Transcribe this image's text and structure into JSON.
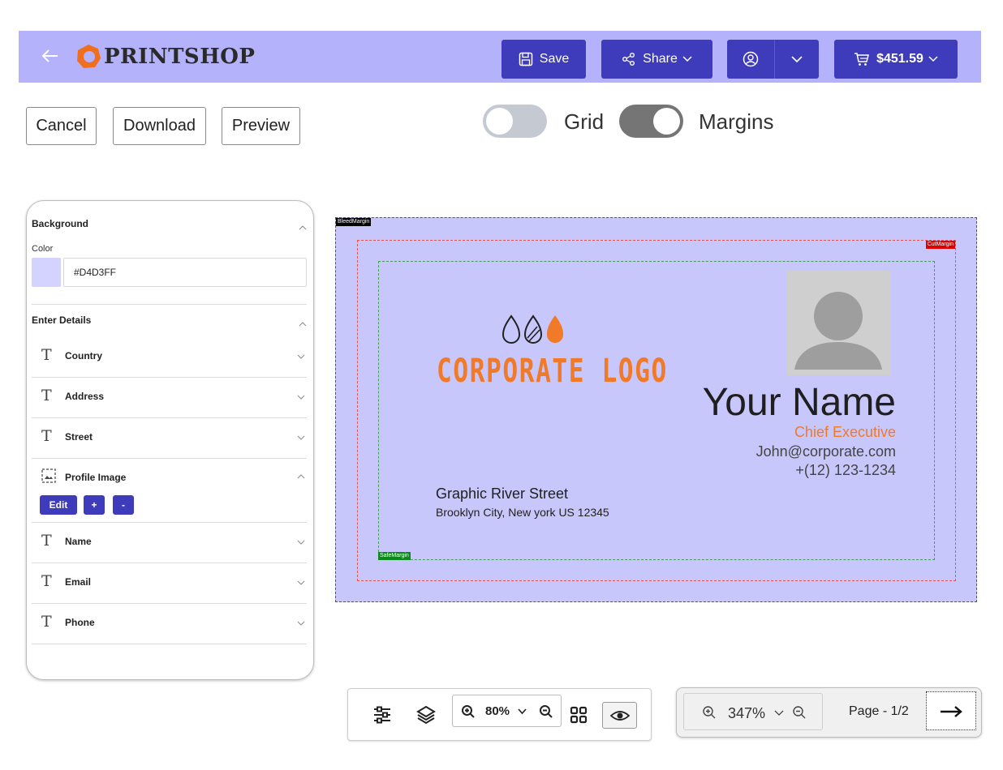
{
  "header": {
    "brand": "PRINTSHOP",
    "save_label": "Save",
    "share_label": "Share",
    "cart_label": "$451.59",
    "icons": [
      "back-arrow-icon",
      "save-icon",
      "share-icon",
      "account-icon",
      "chevron-down-icon",
      "cart-icon"
    ]
  },
  "actions": {
    "cancel": "Cancel",
    "download": "Download",
    "preview": "Preview"
  },
  "toggles": {
    "grid": {
      "label": "Grid",
      "on": false
    },
    "margins": {
      "label": "Margins",
      "on": true
    }
  },
  "panel": {
    "background": {
      "title": "Background",
      "color_label": "Color",
      "color_value": "#D4D3FF"
    },
    "details": {
      "title": "Enter Details",
      "fields": {
        "country": "Country",
        "address": "Address",
        "street": "Street",
        "profile_image": "Profile Image",
        "name": "Name",
        "email": "Email",
        "phone": "Phone"
      },
      "image_buttons": {
        "edit": "Edit",
        "add": "+",
        "remove": "-"
      }
    }
  },
  "card": {
    "bleed_tag": "BleedMargin",
    "cut_tag": "CutMargin",
    "safe_tag": "SafeMargin",
    "logo_text": "CORPORATE LOGO",
    "name": "Your Name",
    "role": "Chief Executive",
    "email": "John@corporate.com",
    "phone": "+(12) 123-1234",
    "street": "Graphic River Street",
    "city": "Brooklyn City, New york US 12345",
    "background_color": "#c8c7fb",
    "accent_color": "#f07a28"
  },
  "toolbar": {
    "zoom": "80%"
  },
  "pager": {
    "zoom": "347%",
    "page": "Page - 1/2"
  },
  "colors": {
    "header_bg": "#b3b2fb",
    "button_bg": "#3f3cbb"
  }
}
